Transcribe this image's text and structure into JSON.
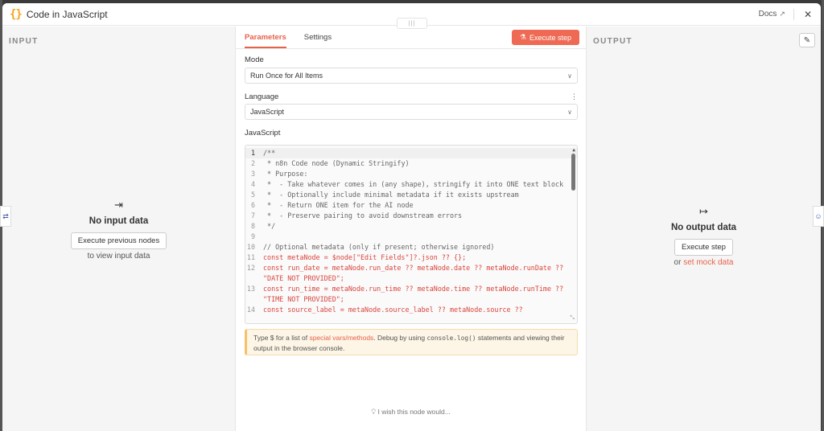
{
  "header": {
    "icon": "{}",
    "title": "Code in JavaScript",
    "docs_label": "Docs",
    "close_symbol": "✕",
    "drag_handle": "|||"
  },
  "input_panel": {
    "label": "INPUT",
    "empty_icon": "⇥",
    "empty_title": "No input data",
    "button_label": "Execute previous nodes",
    "subtext": "to view input data"
  },
  "output_panel": {
    "label": "OUTPUT",
    "edit_icon": "✎",
    "empty_icon": "↦",
    "empty_title": "No output data",
    "button_label": "Execute step",
    "or_text": "or",
    "mock_link": "set mock data"
  },
  "center": {
    "tabs": [
      {
        "label": "Parameters",
        "active": true
      },
      {
        "label": "Settings",
        "active": false
      }
    ],
    "execute_label": "Execute step",
    "mode_label": "Mode",
    "mode_value": "Run Once for All Items",
    "language_label": "Language",
    "language_value": "JavaScript",
    "code_label": "JavaScript",
    "hint": {
      "pre": "Type $ for a list of ",
      "link": "special vars/methods",
      "mid": ". Debug by using ",
      "code": "console.log()",
      "post": " statements and viewing their output in the browser console."
    },
    "wish_text": "I wish this node would..."
  },
  "code_lines": [
    {
      "n": "1",
      "t": "/**"
    },
    {
      "n": "2",
      "t": " * n8n Code node (Dynamic Stringify)"
    },
    {
      "n": "3",
      "t": " * Purpose:"
    },
    {
      "n": "4",
      "t": " *  - Take whatever comes in (any shape), stringify it into ONE text block"
    },
    {
      "n": "5",
      "t": " *  - Optionally include minimal metadata if it exists upstream"
    },
    {
      "n": "6",
      "t": " *  - Return ONE item for the AI node"
    },
    {
      "n": "7",
      "t": " *  - Preserve pairing to avoid downstream errors"
    },
    {
      "n": "8",
      "t": " */"
    },
    {
      "n": "9",
      "t": ""
    },
    {
      "n": "10",
      "t": "// Optional metadata (only if present; otherwise ignored)"
    },
    {
      "n": "11",
      "t": "const metaNode = $node[\"Edit Fields\"]?.json ?? {};"
    },
    {
      "n": "12",
      "t": "const run_date = metaNode.run_date ?? metaNode.date ?? metaNode.runDate ?? \"DATE NOT PROVIDED\";"
    },
    {
      "n": "13",
      "t": "const run_time = metaNode.run_time ?? metaNode.time ?? metaNode.runTime ?? \"TIME NOT PROVIDED\";"
    },
    {
      "n": "14",
      "t": "const source_label = metaNode.source_label ?? metaNode.source ??"
    }
  ],
  "colors": {
    "accent": "#ee6a54",
    "brace": "#f7a21a",
    "keyword": "#d9453d",
    "variable": "#2c5bb3"
  }
}
